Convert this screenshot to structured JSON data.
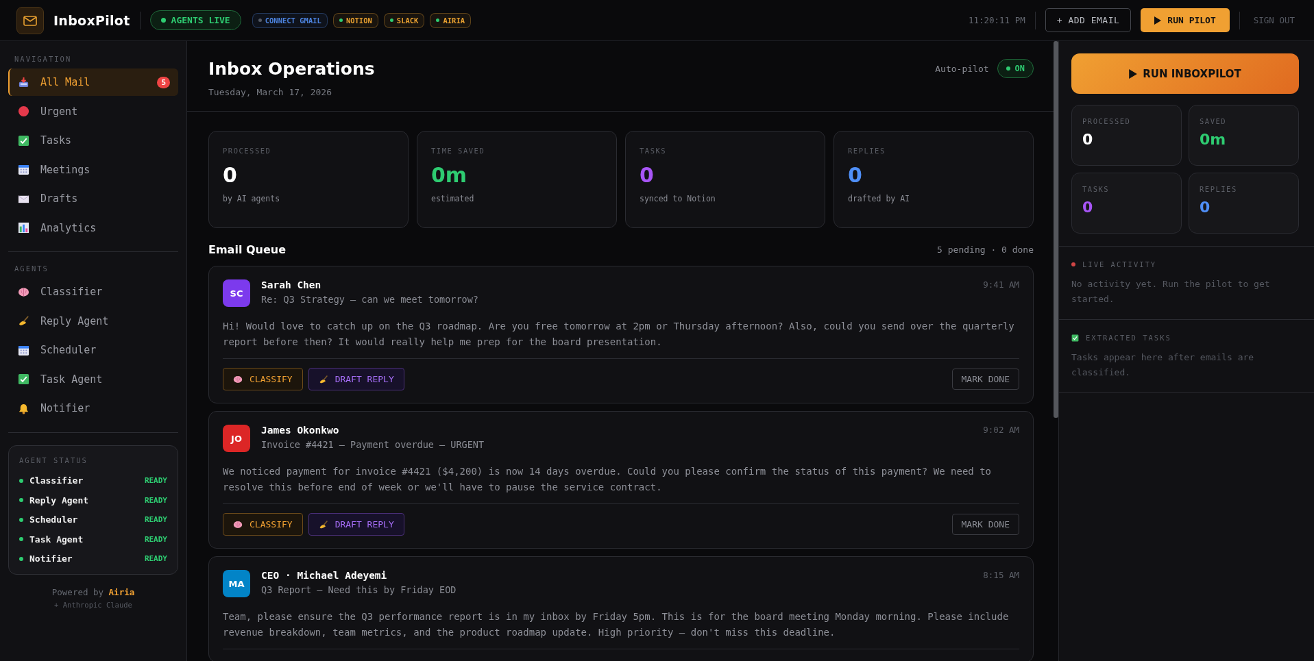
{
  "topbar": {
    "brand": "InboxPilot",
    "agents_live": "AGENTS LIVE",
    "integrations": [
      {
        "label": "CONNECT GMAIL",
        "color": "#4d84e0",
        "connected": false
      },
      {
        "label": "NOTION",
        "color": "#e8a030",
        "connected": true
      },
      {
        "label": "SLACK",
        "color": "#e8a030",
        "connected": true
      },
      {
        "label": "AIRIA",
        "color": "#e8a030",
        "connected": true
      }
    ],
    "time": "11:20:11 PM",
    "add_email": "+ ADD EMAIL",
    "run_pilot": "RUN PILOT",
    "sign_out": "SIGN OUT"
  },
  "sidebar": {
    "navigation_title": "NAVIGATION",
    "nav_items": [
      {
        "label": "All Mail",
        "kind": "inbox",
        "selected": true,
        "badge": "5"
      },
      {
        "label": "Urgent",
        "kind": "urgent",
        "selected": false
      },
      {
        "label": "Tasks",
        "kind": "check",
        "selected": false
      },
      {
        "label": "Meetings",
        "kind": "calendar",
        "selected": false
      },
      {
        "label": "Drafts",
        "kind": "envelope",
        "selected": false
      },
      {
        "label": "Analytics",
        "kind": "chart",
        "selected": false
      }
    ],
    "agents_title": "AGENTS",
    "agent_items": [
      {
        "label": "Classifier",
        "kind": "brain",
        "selected": false
      },
      {
        "label": "Reply Agent",
        "kind": "writing",
        "selected": false
      },
      {
        "label": "Scheduler",
        "kind": "calendar",
        "selected": false
      },
      {
        "label": "Task Agent",
        "kind": "check",
        "selected": false
      },
      {
        "label": "Notifier",
        "kind": "bell",
        "selected": false
      }
    ],
    "agent_status": {
      "title": "AGENT STATUS",
      "items": [
        {
          "name": "Classifier",
          "status": "READY",
          "ready": true
        },
        {
          "name": "Reply Agent",
          "status": "READY",
          "ready": true
        },
        {
          "name": "Scheduler",
          "status": "READY",
          "ready": true
        },
        {
          "name": "Task Agent",
          "status": "READY",
          "ready": true
        },
        {
          "name": "Notifier",
          "status": "READY",
          "ready": true
        }
      ]
    },
    "powered_by": "Powered by **Airia**",
    "powered_sub": "+ Anthropic Claude"
  },
  "main": {
    "title": "Inbox Operations",
    "date": "Tuesday, March 17, 2026",
    "autopilot": {
      "label": "Auto-pilot",
      "state_text": "ON",
      "on": true
    },
    "stats": [
      {
        "label": "PROCESSED",
        "value": "0",
        "caption": "by AI agents",
        "color": "#ffffff"
      },
      {
        "label": "TIME SAVED",
        "value": "0m",
        "caption": "estimated",
        "color": "#2ecc71"
      },
      {
        "label": "TASKS",
        "value": "0",
        "caption": "synced to Notion",
        "color": "#a855f7"
      },
      {
        "label": "REPLIES",
        "value": "0",
        "caption": "drafted by AI",
        "color": "#4f8ff7"
      }
    ],
    "queue_title": "Email Queue",
    "queue_count": "5 pending · 0 done",
    "emails": [
      {
        "initials": "SC",
        "color": "#7c3aed",
        "sender": "Sarah Chen",
        "subject": "Re: Q3 Strategy — can we meet tomorrow?",
        "time": "9:41 AM",
        "body": "Hi! Would love to catch up on the Q3 roadmap. Are you free tomorrow at 2pm or Thursday afternoon? Also, could you send over the quarterly report before then? It would really help me prep for the board presentation.",
        "actions": {
          "classify": "CLASSIFY",
          "draft_reply": "DRAFT REPLY",
          "mark_done": "MARK DONE"
        }
      },
      {
        "initials": "JO",
        "color": "#dc2626",
        "sender": "James Okonkwo",
        "subject": "Invoice #4421 — Payment overdue — URGENT",
        "time": "9:02 AM",
        "body": "We noticed payment for invoice #4421 ($4,200) is now 14 days overdue. Could you please confirm the status of this payment? We need to resolve this before end of week or we'll have to pause the service contract.",
        "actions": {
          "classify": "CLASSIFY",
          "draft_reply": "DRAFT REPLY",
          "mark_done": "MARK DONE"
        }
      },
      {
        "initials": "MA",
        "color": "#0284c7",
        "sender": "CEO · Michael Adeyemi",
        "subject": "Q3 Report — Need this by Friday EOD",
        "time": "8:15 AM",
        "body": "Team, please ensure the Q3 performance report is in my inbox by Friday 5pm. This is for the board meeting Monday morning. Please include revenue breakdown, team metrics, and the product roadmap update. High priority — don't miss this deadline."
      }
    ]
  },
  "right_panel": {
    "run_button": "RUN INBOXPILOT",
    "stats": [
      {
        "label": "PROCESSED",
        "value": "0",
        "color": "#ffffff"
      },
      {
        "label": "SAVED",
        "value": "0m",
        "color": "#2ecc71"
      },
      {
        "label": "TASKS",
        "value": "0",
        "color": "#a855f7"
      },
      {
        "label": "REPLIES",
        "value": "0",
        "color": "#4f8ff7"
      }
    ],
    "live_activity_title": "LIVE ACTIVITY",
    "live_activity_text": "No activity yet. Run the pilot to get started.",
    "tasks_title": "EXTRACTED TASKS",
    "tasks_text": "Tasks appear here after emails are classified."
  }
}
